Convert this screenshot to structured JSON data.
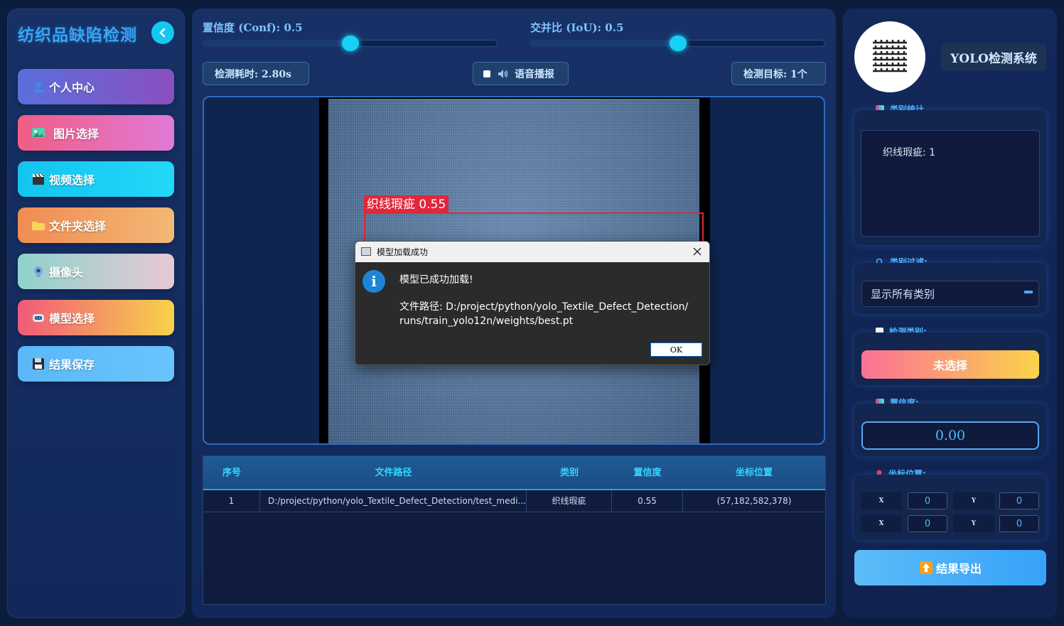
{
  "sidebar": {
    "title": "纺织品缺陷检测",
    "items": [
      {
        "label": "个人中心"
      },
      {
        "label": "图片选择"
      },
      {
        "label": "视频选择"
      },
      {
        "label": "文件夹选择"
      },
      {
        "label": "摄像头"
      },
      {
        "label": "模型选择"
      },
      {
        "label": "结果保存"
      }
    ]
  },
  "controls": {
    "conf_label": "置信度 (Conf): 0.5",
    "conf_value": 0.5,
    "iou_label": "交并比 (IoU): 0.5",
    "iou_value": 0.5,
    "time_label": "检测耗时: 2.80s",
    "voice_label": "语音播报",
    "target_label": "检测目标: 1个"
  },
  "detection": {
    "label": "织线瑕疵 0.55"
  },
  "table": {
    "headers": [
      "序号",
      "文件路径",
      "类别",
      "置信度",
      "坐标位置"
    ],
    "rows": [
      [
        "1",
        "D:/project/python/yolo_Textile_Defect_Detection/test_medi...",
        "织线瑕疵",
        "0.55",
        "(57,182,582,378)"
      ]
    ]
  },
  "dialog": {
    "title": "模型加载成功",
    "message": "模型已成功加载!",
    "path_line1": "文件路径: D:/project/python/yolo_Textile_Defect_Detection/",
    "path_line2": "runs/train_yolo12n/weights/best.pt",
    "ok_label": "OK"
  },
  "right": {
    "system_title": "YOLO检测系统",
    "stats_label": "类别统计",
    "stats_text": "织线瑕疵: 1",
    "filter_label": "类别过滤:",
    "filter_value": "显示所有类别",
    "class_label": "检测类别:",
    "class_value": "未选择",
    "conf_label": "置信度:",
    "conf_value": "0.00",
    "coord_label": "坐标位置:",
    "coords": {
      "x1_label": "X",
      "x1": "0",
      "y1_label": "Y",
      "y1": "0",
      "x2_label": "X",
      "x2": "0",
      "y2_label": "Y",
      "y2": "0"
    },
    "export_label": "结果导出"
  },
  "colors": {
    "accent": "#18d0f6",
    "title_blue": "#35a6f5",
    "detect_red": "#e0283c"
  }
}
